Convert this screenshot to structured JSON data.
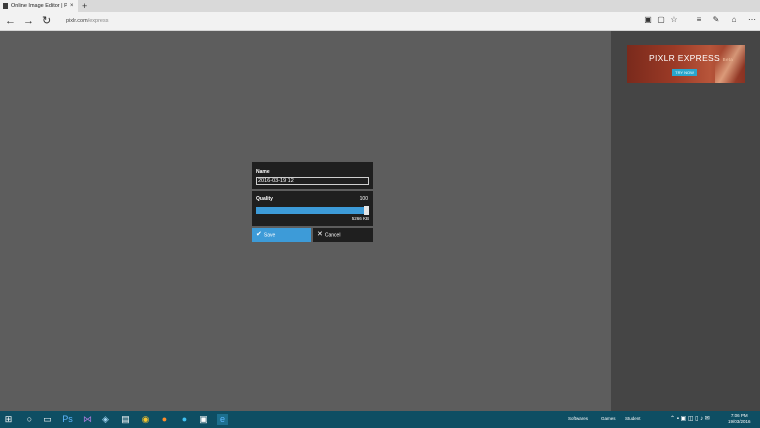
{
  "browser": {
    "tab_title": "Online Image Editor | Pi",
    "tab_close": "×",
    "new_tab": "+",
    "address_host": "pixlr.com",
    "address_path": "/express",
    "nav": {
      "back": "←",
      "forward": "→",
      "refresh": "↻"
    }
  },
  "ad": {
    "brand": "PIXLR EXPRESS",
    "beta": "Beta",
    "cta": "TRY NOW"
  },
  "dialog": {
    "name_label": "Name",
    "name_value": "2016-03-19 12",
    "quality_label": "Quality",
    "quality_value": "100",
    "quality_fraction": 1.0,
    "file_size": "5266 KB",
    "save_label": "Save",
    "cancel_label": "Cancel"
  },
  "taskbar": {
    "tray_items": [
      "Softwares",
      "Games",
      "Student"
    ],
    "clock_time": "7:06 PM",
    "clock_date": "19/03/2016"
  },
  "colors": {
    "accent": "#3d9bd8",
    "dialog_bg": "#1f1f1f",
    "canvas_bg": "#5d5d5d",
    "taskbar": "#0e4e63"
  }
}
